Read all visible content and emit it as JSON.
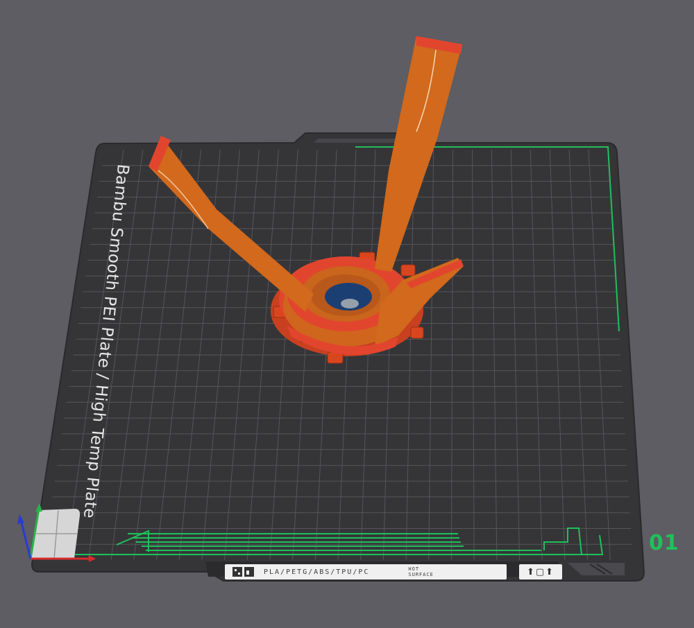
{
  "viewport": {
    "plate_name": "Bambu Smooth PEI Plate / High Temp Plate",
    "plate_number": "01",
    "plate_strip": {
      "materials": "PLA/PETG/ABS/TPU/PC",
      "hot_line1": "HOT",
      "hot_line2": "SURFACE",
      "icons_text": "⬆▢⬆"
    },
    "icons": {
      "axis_gizmo": "xyz-axes-icon",
      "warning": "warning-triangle-icon",
      "material_glyphs": "filament-type-icon"
    }
  },
  "colors": {
    "background": "#5d5d63",
    "plate": "#37373a",
    "grid": "#55555a",
    "plate_border": "#1fc15a",
    "model_orange": "#d2691c",
    "model_top": "#e0452f",
    "model_inner": "#1c3f73",
    "axis_x": "#d62b2b",
    "axis_y": "#2ab24a",
    "axis_z": "#2a3ad4",
    "label_text": "#e8e8e8",
    "number_text": "#1fc15a"
  }
}
